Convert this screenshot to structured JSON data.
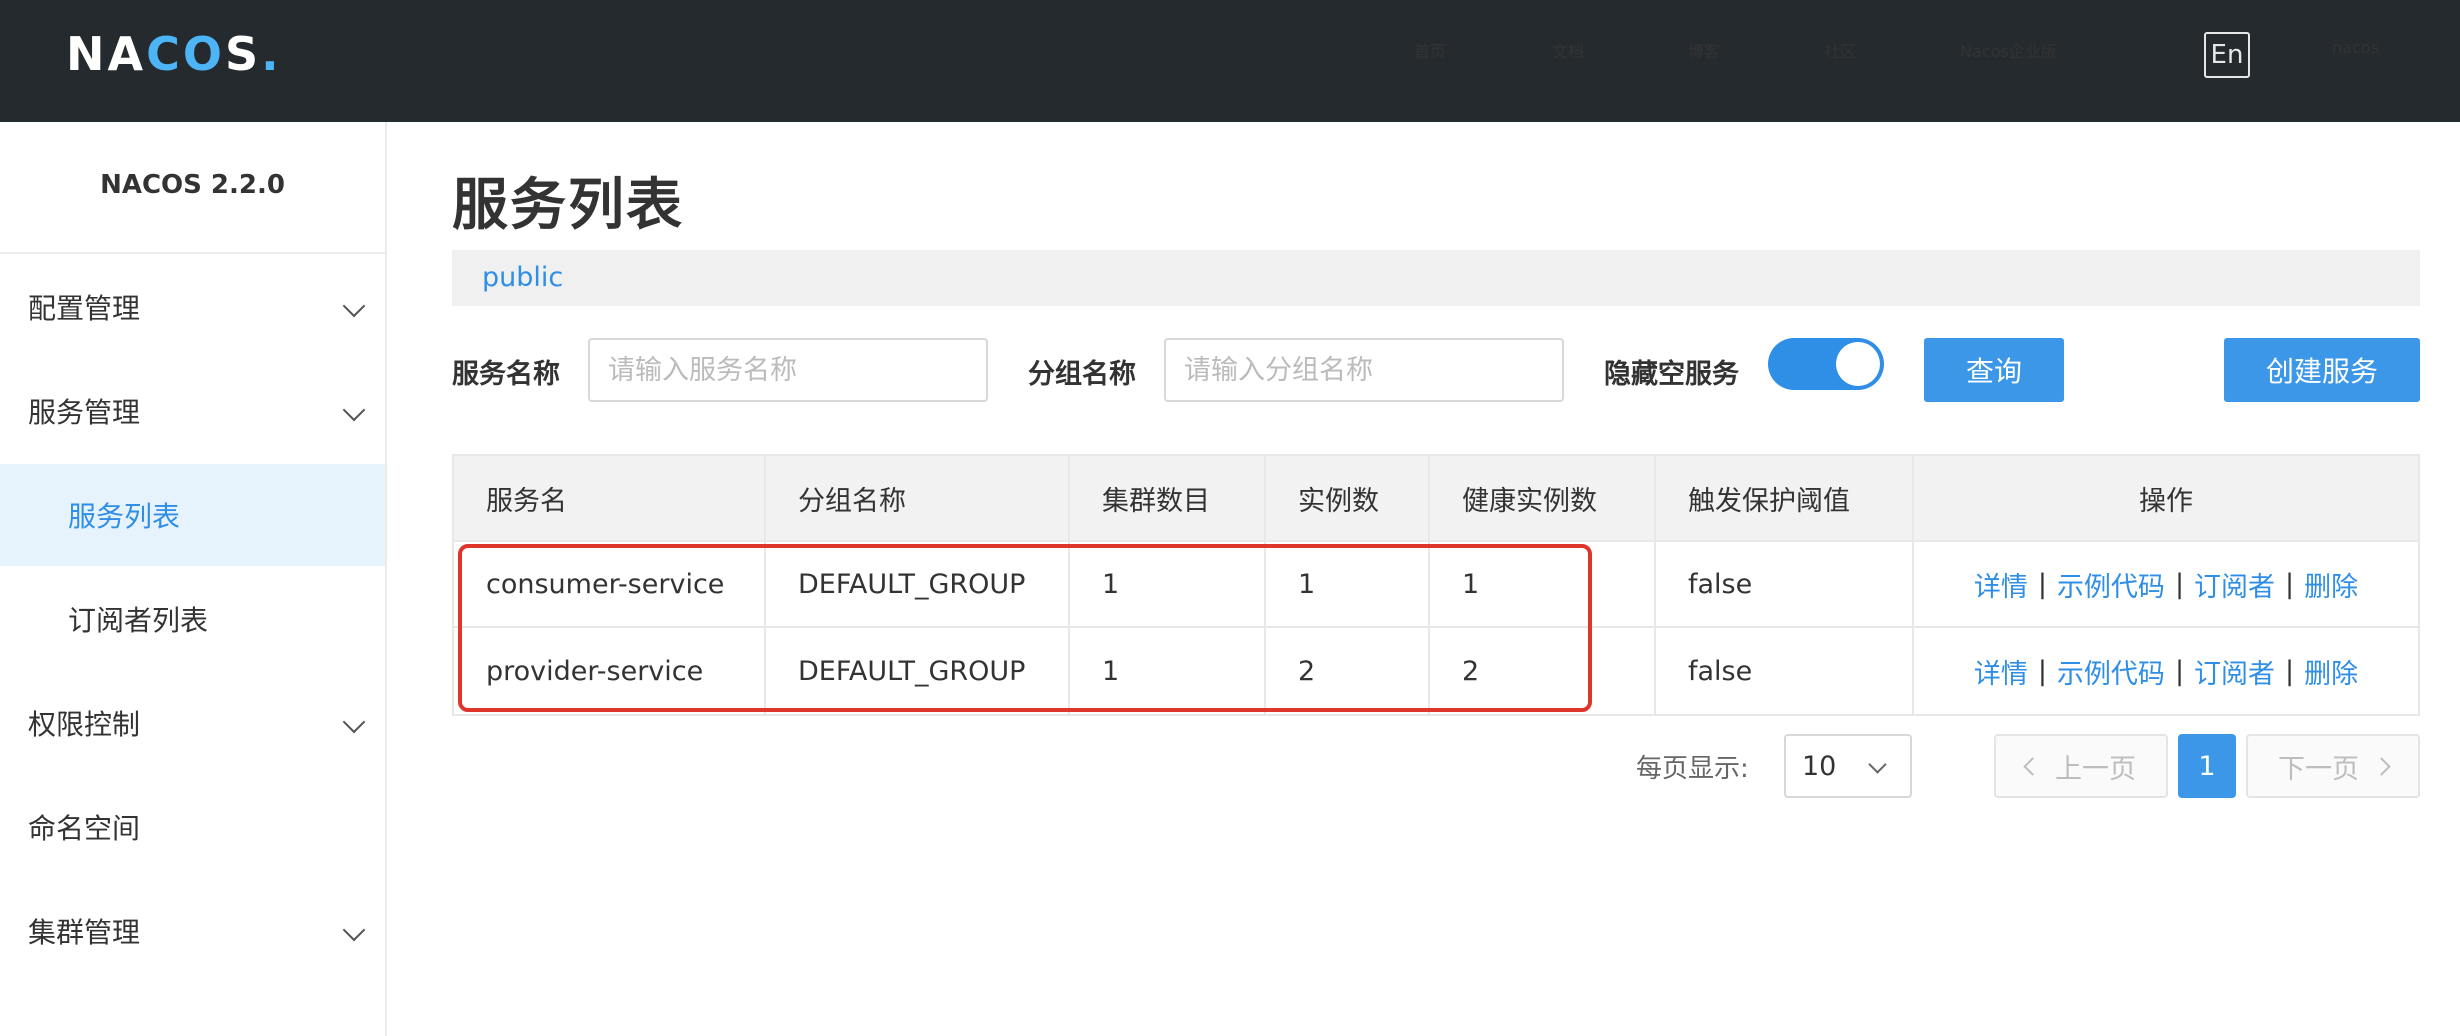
{
  "header": {
    "logo": "NACOS.",
    "nav": [
      "首页",
      "文档",
      "博客",
      "社区",
      "Nacos企业版"
    ],
    "lang": "En",
    "user": "nacos"
  },
  "sidebar": {
    "version": "NACOS 2.2.0",
    "items": [
      {
        "label": "配置管理",
        "expandable": true
      },
      {
        "label": "服务管理",
        "expandable": true
      },
      {
        "label": "服务列表",
        "sub": true,
        "active": true
      },
      {
        "label": "订阅者列表",
        "sub": true
      },
      {
        "label": "权限控制",
        "expandable": true
      },
      {
        "label": "命名空间"
      },
      {
        "label": "集群管理",
        "expandable": true
      }
    ]
  },
  "main": {
    "title": "服务列表",
    "namespace": "public",
    "filters": {
      "service_label": "服务名称",
      "service_placeholder": "请输入服务名称",
      "group_label": "分组名称",
      "group_placeholder": "请输入分组名称",
      "hide_empty_label": "隐藏空服务",
      "hide_empty_on": true
    },
    "query_button": "查询",
    "create_button": "创建服务",
    "table": {
      "columns": [
        "服务名",
        "分组名称",
        "集群数目",
        "实例数",
        "健康实例数",
        "触发保护阈值",
        "操作"
      ],
      "rows": [
        [
          "consumer-service",
          "DEFAULT_GROUP",
          "1",
          "1",
          "1",
          "false"
        ],
        [
          "provider-service",
          "DEFAULT_GROUP",
          "1",
          "2",
          "2",
          "false"
        ]
      ],
      "ops": [
        "详情",
        "示例代码",
        "订阅者",
        "删除"
      ],
      "ops_sep": "|"
    },
    "pagination": {
      "page_size_label": "每页显示:",
      "page_size": "10",
      "prev": "上一页",
      "next": "下一页",
      "current": "1"
    }
  },
  "colors": {
    "topbar": "#252a2f",
    "accent": "#3d97e8",
    "link": "#2f8ee6",
    "highlight_box": "#e0352b"
  }
}
